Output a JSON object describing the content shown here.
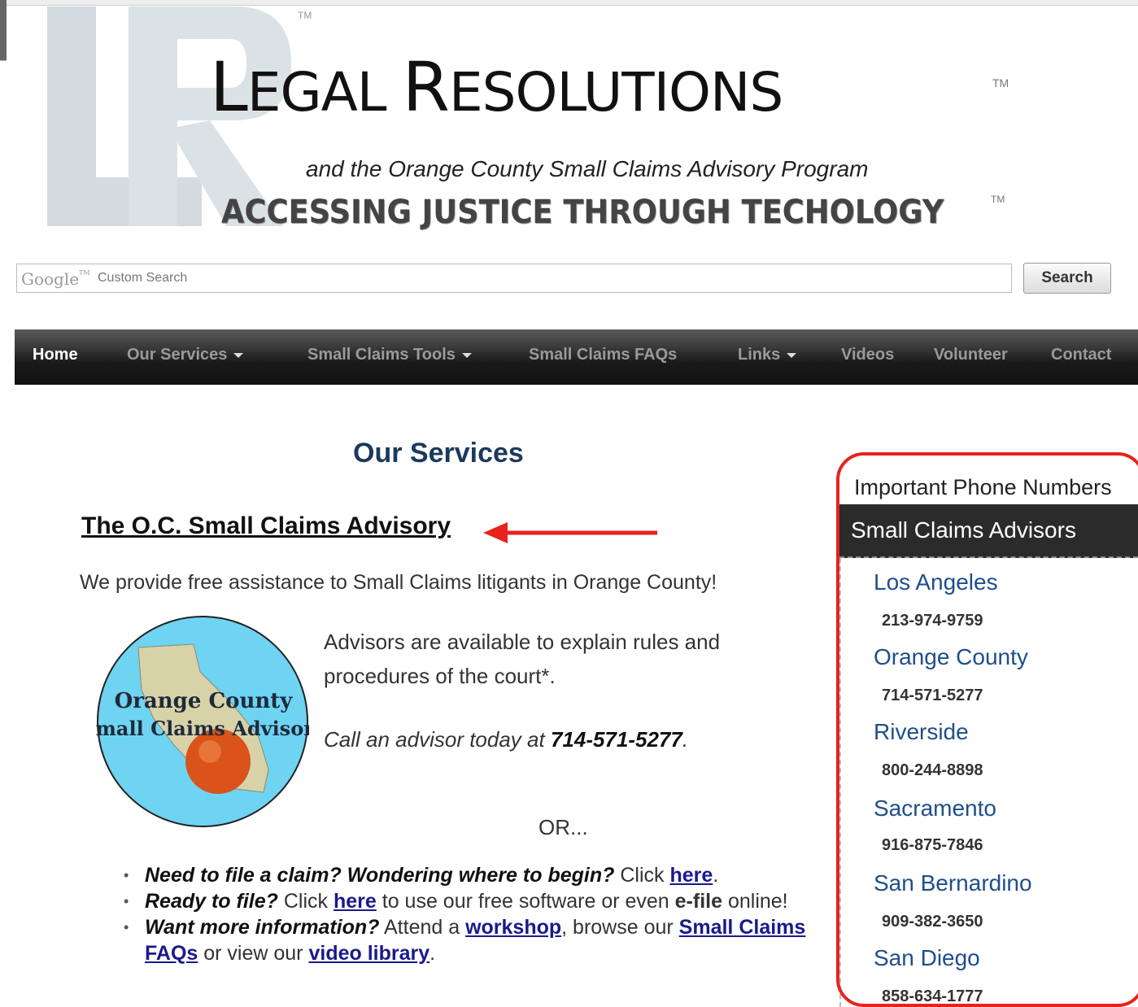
{
  "header": {
    "brand_first": "L",
    "brand_rest1": "EGAL ",
    "brand_second": "R",
    "brand_rest2": "ESOLUTIONS",
    "trademark": "TM",
    "tagline": "and the Orange County Small Claims Advisory Program",
    "motto": "ACCESSING JUSTICE  THROUGH TECHOLOGY",
    "motto_trademark": "TM"
  },
  "search": {
    "brand": "Google",
    "brand_tm": "TM",
    "placeholder": "Custom Search",
    "button_label": "Search"
  },
  "nav": {
    "items": [
      {
        "label": "Home",
        "active": true,
        "dropdown": false
      },
      {
        "label": "Our Services",
        "active": false,
        "dropdown": true
      },
      {
        "label": "Small Claims Tools",
        "active": false,
        "dropdown": true
      },
      {
        "label": "Small Claims FAQs",
        "active": false,
        "dropdown": false
      },
      {
        "label": "Links",
        "active": false,
        "dropdown": true
      },
      {
        "label": "Videos",
        "active": false,
        "dropdown": false
      },
      {
        "label": "Volunteer",
        "active": false,
        "dropdown": false
      },
      {
        "label": "Contact",
        "active": false,
        "dropdown": false
      }
    ]
  },
  "main": {
    "page_title": "Our Services",
    "section_heading": "The O.C. Small Claims Advisory",
    "intro": "We provide free assistance to Small Claims litigants in Orange County!",
    "badge_line1": "Orange County",
    "badge_line2": "Small Claims Advisory",
    "advisors_text": "Advisors are available to explain rules and procedures of the court*.",
    "call_prefix": "Call an advisor today at ",
    "call_number": "714-571-5277",
    "call_suffix": ".",
    "or_text": "OR...",
    "bullet1": {
      "question": "Need to file a claim? Wondering where to begin?",
      "text1": " Click ",
      "link": "here",
      "text2": "."
    },
    "bullet2": {
      "question": "Ready to file?",
      "text1": " Click ",
      "link": "here",
      "text2": " to use our free software or even ",
      "bold": "e-file",
      "text3": " online!"
    },
    "bullet3": {
      "question": "Want more information?",
      "text1": " Attend a ",
      "link1": "workshop",
      "text2": ", browse our ",
      "link2": "Small Claims FAQs",
      "text3": " or view our ",
      "link3": "video library",
      "text4": "."
    }
  },
  "sidebar": {
    "title": "Important Phone Numbers",
    "section": "Small Claims Advisors",
    "entries": [
      {
        "city": "Los Angeles",
        "phone": "213-974-9759"
      },
      {
        "city": "Orange County",
        "phone": "714-571-5277"
      },
      {
        "city": "Riverside",
        "phone": "800-244-8898"
      },
      {
        "city": "Sacramento",
        "phone": "916-875-7846"
      },
      {
        "city": "San Bernardino",
        "phone": "909-382-3650"
      },
      {
        "city": "San Diego",
        "phone": "858-634-1777"
      }
    ]
  },
  "colors": {
    "annotation": "#e8221c",
    "link": "#1a1a8c",
    "city": "#1f4e8c",
    "title": "#1b3a5c"
  }
}
